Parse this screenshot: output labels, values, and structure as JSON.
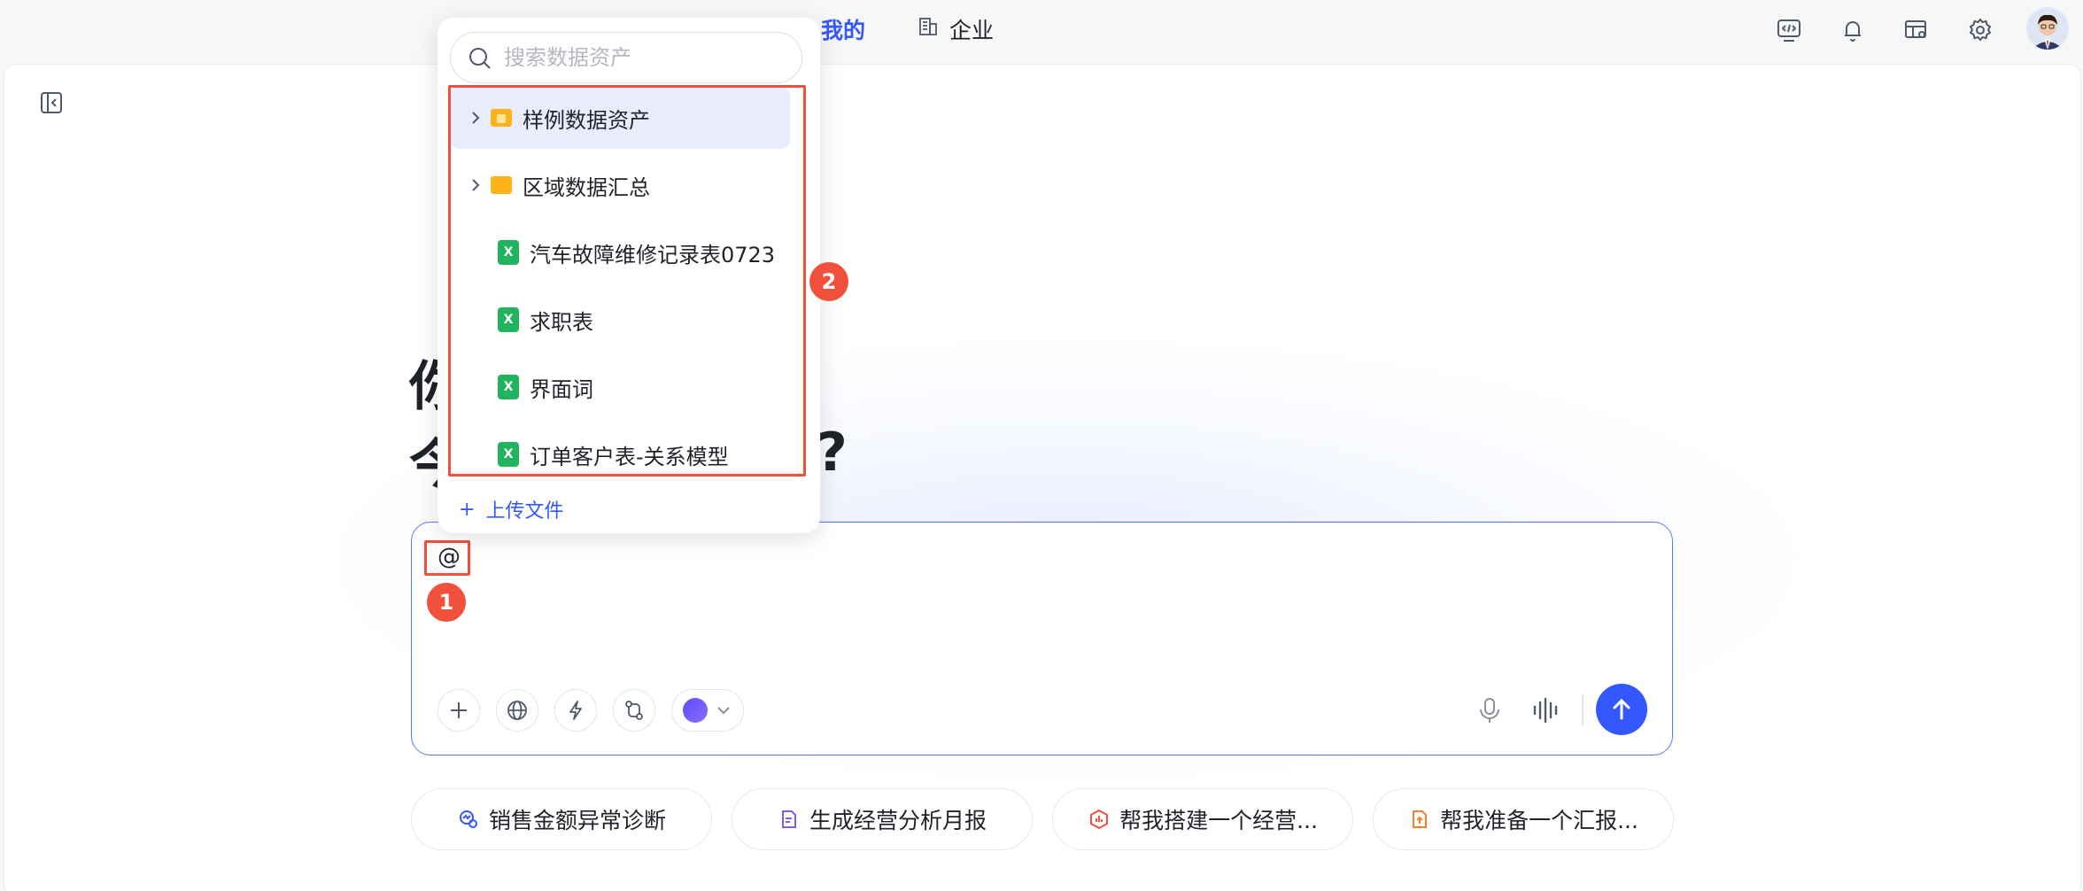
{
  "topbar": {
    "tabs": [
      {
        "label": "我的",
        "active": true
      },
      {
        "label": "企业",
        "active": false
      }
    ],
    "icons": [
      "code-panel-icon",
      "bell-icon",
      "data-settings-icon",
      "gear-icon",
      "user-avatar"
    ]
  },
  "greeting": {
    "line1": "你",
    "line2": "今",
    "line2_end": "?"
  },
  "input": {
    "value": "@",
    "tools": [
      "plus-icon",
      "globe-icon",
      "lightning-icon",
      "workflow-icon"
    ],
    "model_selector": "model-icon"
  },
  "dropdown": {
    "search_placeholder": "搜索数据资产",
    "items": [
      {
        "type": "folder",
        "label": "样例数据资产",
        "expandable": true,
        "selected": true
      },
      {
        "type": "folder",
        "label": "区域数据汇总",
        "expandable": true,
        "selected": false
      },
      {
        "type": "excel",
        "label": "汽车故障维修记录表0723",
        "icon_text": "X"
      },
      {
        "type": "excel",
        "label": "求职表",
        "icon_text": "X"
      },
      {
        "type": "excel",
        "label": "界面词",
        "icon_text": "X"
      },
      {
        "type": "excel",
        "label": "订单客户表-关系模型",
        "icon_text": "X"
      }
    ],
    "upload_label": "上传文件",
    "upload_prefix": "+"
  },
  "annotations": {
    "badge1": "1",
    "badge2": "2",
    "color": "#f0503c"
  },
  "suggestions": [
    {
      "label": "销售金额异常诊断",
      "icon": "diagnosis-icon",
      "color": "#3358ff"
    },
    {
      "label": "生成经营分析月报",
      "icon": "report-icon",
      "color": "#7a5cff"
    },
    {
      "label": "帮我搭建一个经营...",
      "icon": "dashboard-icon",
      "color": "#f0503c"
    },
    {
      "label": "帮我准备一个汇报...",
      "icon": "upload-doc-icon",
      "color": "#ff7d2e"
    }
  ],
  "colors": {
    "accent": "#3358ff",
    "folder": "#ffb31a",
    "excel": "#22b35e"
  }
}
